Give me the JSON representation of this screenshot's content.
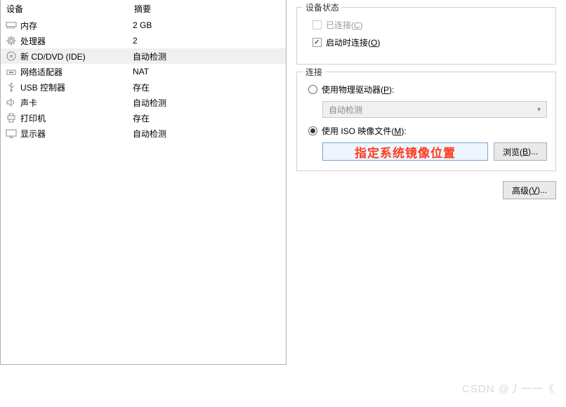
{
  "leftPanel": {
    "headers": {
      "device": "设备",
      "summary": "摘要"
    },
    "devices": [
      {
        "icon": "memory",
        "name": "内存",
        "summary": "2 GB",
        "selected": false
      },
      {
        "icon": "cpu",
        "name": "处理器",
        "summary": "2",
        "selected": false
      },
      {
        "icon": "disc",
        "name": "新 CD/DVD (IDE)",
        "summary": "自动检测",
        "selected": true
      },
      {
        "icon": "network",
        "name": "网络适配器",
        "summary": "NAT",
        "selected": false
      },
      {
        "icon": "usb",
        "name": "USB 控制器",
        "summary": "存在",
        "selected": false
      },
      {
        "icon": "sound",
        "name": "声卡",
        "summary": "自动检测",
        "selected": false
      },
      {
        "icon": "printer",
        "name": "打印机",
        "summary": "存在",
        "selected": false
      },
      {
        "icon": "display",
        "name": "显示器",
        "summary": "自动检测",
        "selected": false
      }
    ]
  },
  "rightPanel": {
    "status": {
      "title": "设备状态",
      "connected": {
        "label_pre": "已连接(",
        "accel": "C",
        "label_post": ")",
        "checked": false,
        "enabled": false
      },
      "connectOnStart": {
        "label_pre": "启动时连接(",
        "accel": "O",
        "label_post": ")",
        "checked": true,
        "enabled": true
      }
    },
    "connection": {
      "title": "连接",
      "physical": {
        "label_pre": "使用物理驱动器(",
        "accel": "P",
        "label_post": "):",
        "selected": false
      },
      "physicalDropdown": "自动检测",
      "iso": {
        "label_pre": "使用 ISO 映像文件(",
        "accel": "M",
        "label_post": "):",
        "selected": true
      },
      "isoAnnotation": "指定系统镜像位置",
      "browse": {
        "label_pre": "浏览(",
        "accel": "B",
        "label_post": ")..."
      }
    },
    "advanced": {
      "label_pre": "高级(",
      "accel": "V",
      "label_post": ")..."
    }
  },
  "watermark": "CSDN @丿一一《"
}
